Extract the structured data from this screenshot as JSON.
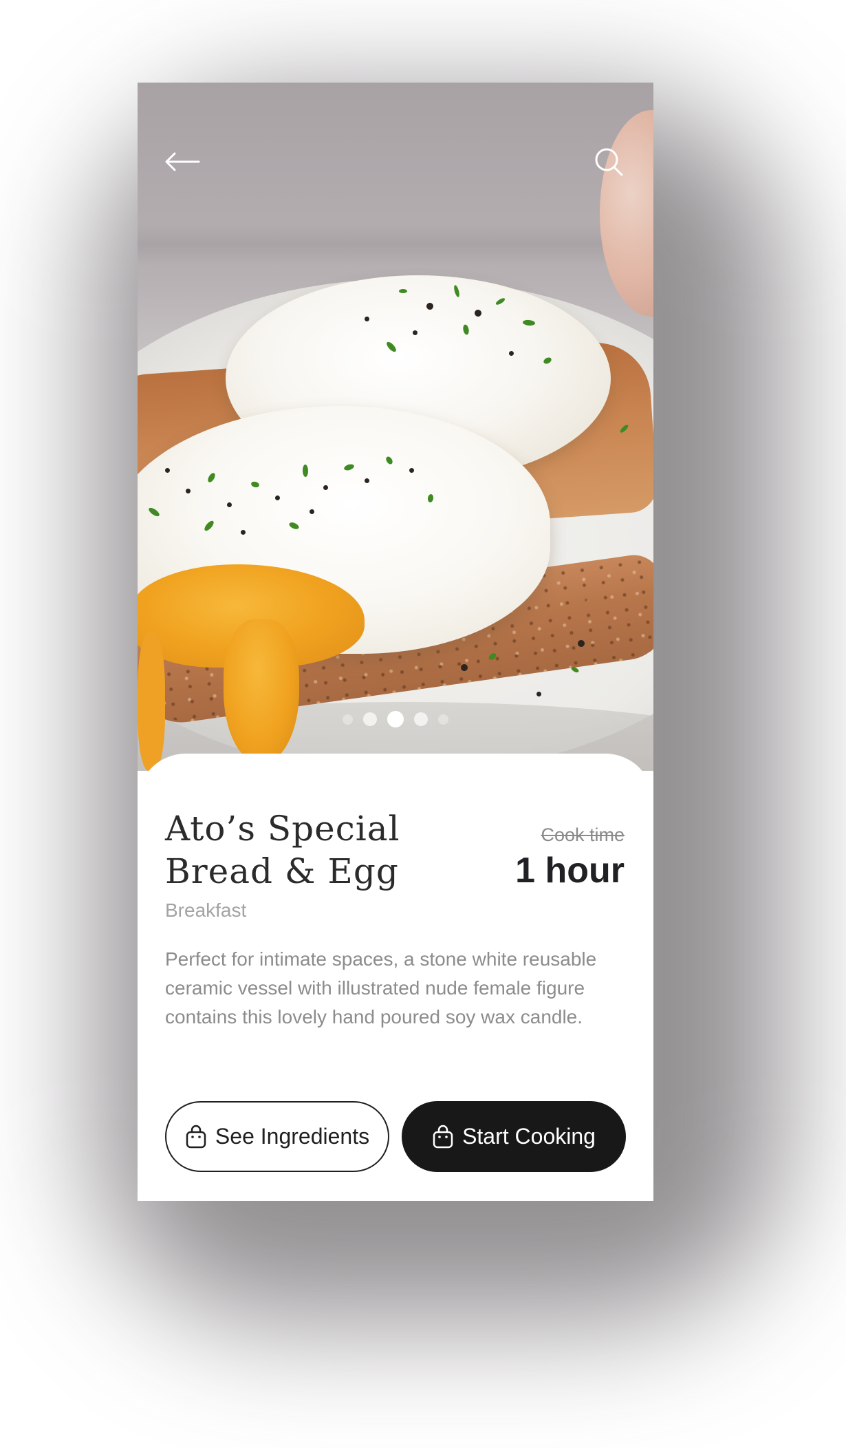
{
  "header": {
    "back_icon": "arrow-left-icon",
    "search_icon": "search-icon"
  },
  "hero": {
    "image_subject": "poached eggs on toast",
    "carousel": {
      "total": 5,
      "active_index": 2
    }
  },
  "recipe": {
    "title_line1": "Ato’s Special",
    "title_line2": "Bread & Egg",
    "category": "Breakfast",
    "cook_time_label": "Cook time",
    "cook_time_value": "1 hour",
    "description": "Perfect for intimate spaces, a stone white reusable ceramic vessel with illustrated nude female figure contains this lovely hand poured soy wax candle."
  },
  "actions": {
    "see_ingredients_label": "See Ingredients",
    "start_cooking_label": "Start Cooking",
    "button_icon": "shopping-bag-icon"
  },
  "colors": {
    "primary_dark": "#181818",
    "text_muted": "#8c8c8c",
    "title": "#2b2b2b",
    "accent_yolk": "#f0a21f"
  }
}
